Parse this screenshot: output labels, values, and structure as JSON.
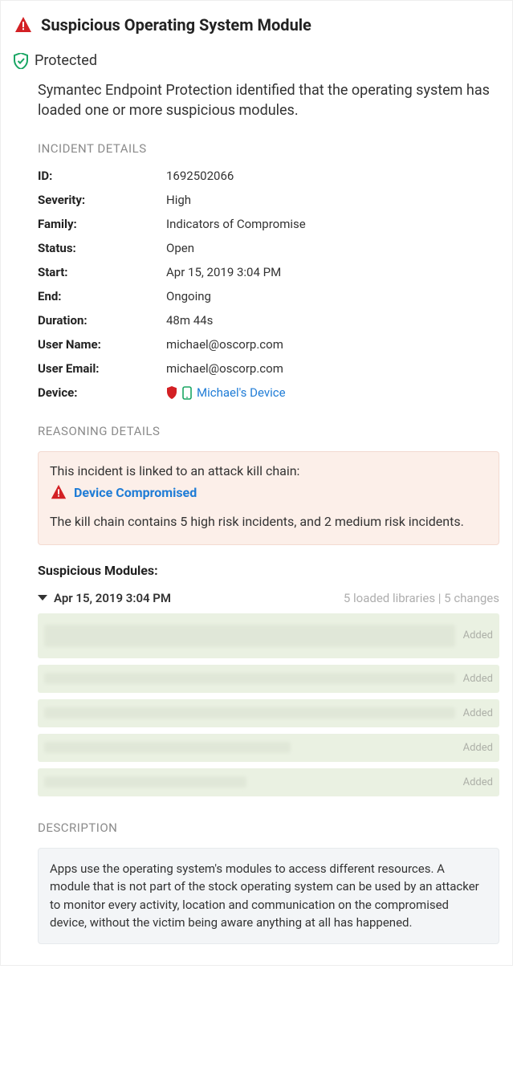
{
  "header": {
    "title": "Suspicious Operating System Module"
  },
  "protected": {
    "label": "Protected"
  },
  "summary_text": "Symantec Endpoint Protection identified that the operating system has loaded one or more suspicious modules.",
  "incident_details": {
    "section_title": "Incident Details",
    "rows": {
      "id": {
        "label": "ID:",
        "value": "1692502066"
      },
      "severity": {
        "label": "Severity:",
        "value": "High"
      },
      "family": {
        "label": "Family:",
        "value": "Indicators of Compromise"
      },
      "status": {
        "label": "Status:",
        "value": "Open"
      },
      "start": {
        "label": "Start:",
        "value": "Apr 15, 2019 3:04 PM"
      },
      "end": {
        "label": "End:",
        "value": "Ongoing"
      },
      "duration": {
        "label": "Duration:",
        "value": "48m 44s"
      },
      "username": {
        "label": "User Name:",
        "value": "michael@oscorp.com"
      },
      "useremail": {
        "label": "User Email:",
        "value": "michael@oscorp.com"
      },
      "device": {
        "label": "Device:",
        "value": "Michael's Device"
      }
    }
  },
  "reasoning": {
    "section_title": "Reasoning Details",
    "linked_text": "This incident is linked to an attack kill chain:",
    "chain_link": "Device Compromised",
    "summary": "The kill chain contains 5 high risk incidents, and 2 medium risk incidents."
  },
  "suspicious_modules": {
    "title": "Suspicious Modules:",
    "timestamp": "Apr 15, 2019 3:04 PM",
    "meta": "5 loaded libraries | 5 changes",
    "items": [
      {
        "status": "Added"
      },
      {
        "status": "Added"
      },
      {
        "status": "Added"
      },
      {
        "status": "Added"
      },
      {
        "status": "Added"
      }
    ]
  },
  "description": {
    "section_title": "Description",
    "text": "Apps use the operating system's modules to access different resources. A module that is not part of the stock operating system can be used by an attacker to monitor every activity, location and communication on the compromised device, without the victim being aware anything at all has happened."
  }
}
